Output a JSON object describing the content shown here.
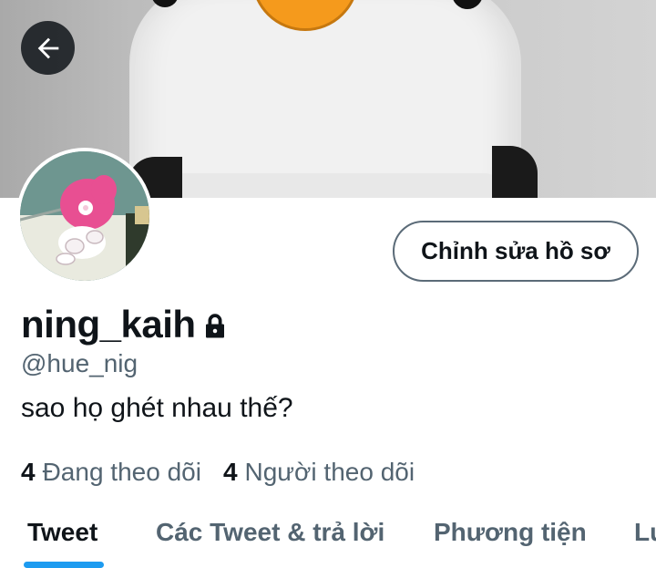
{
  "profile": {
    "display_name": "ning_kaih",
    "handle": "@hue_nig",
    "bio": "sao họ ghét nhau thế?",
    "protected_icon": "lock-icon",
    "avatar_icon": "avatar-image",
    "banner_icon": "penguin-banner-image"
  },
  "header": {
    "back_icon": "arrow-left-icon"
  },
  "actions": {
    "edit_profile_label": "Chỉnh sửa hồ sơ"
  },
  "stats": {
    "following_count": "4",
    "following_label": "Đang theo dõi",
    "followers_count": "4",
    "followers_label": "Người theo dõi"
  },
  "tabs": [
    {
      "label": "Tweet",
      "active": true
    },
    {
      "label": "Các Tweet & trả lời",
      "active": false
    },
    {
      "label": "Phương tiện",
      "active": false
    },
    {
      "label": "Lư",
      "active": false
    }
  ],
  "colors": {
    "accent": "#1d9bf0",
    "text_primary": "#0f1419",
    "text_secondary": "#536471"
  }
}
